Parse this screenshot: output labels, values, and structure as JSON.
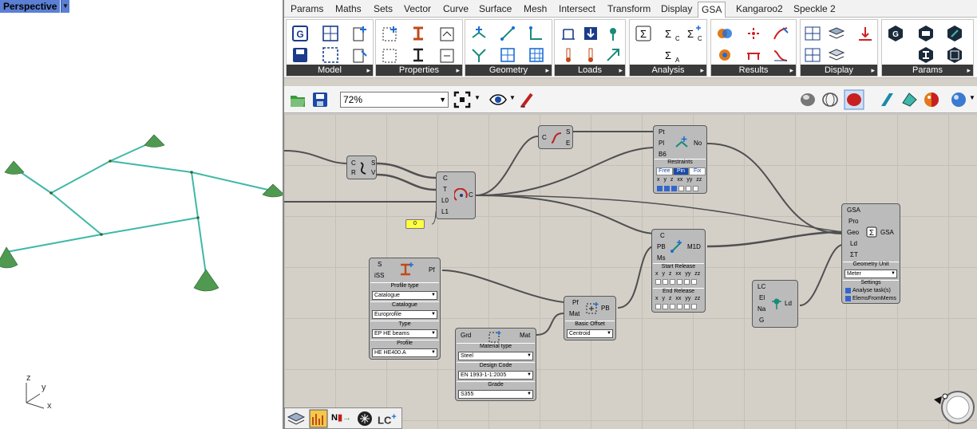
{
  "viewport": {
    "title": "Perspective",
    "axis": {
      "z": "z",
      "y": "y",
      "x": "x"
    }
  },
  "tabs": [
    "Params",
    "Maths",
    "Sets",
    "Vector",
    "Curve",
    "Surface",
    "Mesh",
    "Intersect",
    "Transform",
    "Display",
    "GSA",
    "Kangaroo2",
    "Speckle 2"
  ],
  "active_tab": "GSA",
  "ribbon_panels": [
    "Model",
    "Properties",
    "Geometry",
    "Loads",
    "Analysis",
    "Results",
    "Display",
    "Params"
  ],
  "toolbar": {
    "zoom": "72%"
  },
  "components": {
    "offset": {
      "in1": "C",
      "in2": "R",
      "out1": "S",
      "out2": "V"
    },
    "curve": {
      "in": "C",
      "out1": "S",
      "out2": "E"
    },
    "arc": {
      "in1": "C",
      "in2": "T",
      "in3": "L0",
      "in4": "L1",
      "out": "C"
    },
    "panel_value": "0",
    "node": {
      "in1": "Pt",
      "in2": "Pl",
      "in3": "B6",
      "out": "No",
      "restraints_label": "Restraints",
      "buttons": [
        "Free",
        "Pin",
        "Fix"
      ],
      "axes": [
        "x",
        "y",
        "z",
        "xx",
        "yy",
        "zz"
      ]
    },
    "element1d": {
      "in1": "C",
      "in2": "PB",
      "in3": "Ms",
      "out": "M1D",
      "start_release": "Start Release",
      "end_release": "End Release",
      "axes": [
        "x",
        "y",
        "z",
        "xx",
        "yy",
        "zz"
      ]
    },
    "profile": {
      "in1": "S",
      "in2": "iSS",
      "out": "Pf",
      "label_type": "Profile type",
      "value_type": "Catalogue",
      "label_catalogue": "Catalogue",
      "value_catalogue": "Europrofile",
      "label_kind": "Type",
      "value_kind": "EP HE beams",
      "label_profile": "Profile",
      "value_profile": "HE HE400.A"
    },
    "section": {
      "in1": "Pf",
      "in2": "Mat",
      "out": "PB",
      "label_offset": "Basic Offset",
      "value_offset": "Centroid"
    },
    "material": {
      "in": "Grd",
      "out": "Mat",
      "label_type": "Material type",
      "value_type": "Steel",
      "label_code": "Design Code",
      "value_code": "EN 1993-1-1:2005",
      "label_grade": "Grade",
      "value_grade": "S355"
    },
    "load": {
      "in1": "LC",
      "in2": "El",
      "in3": "Na",
      "in4": "G",
      "out": "Ld"
    },
    "model": {
      "in1": "GSA",
      "in2": "Pro",
      "in3": "Geo",
      "in4": "Ld",
      "in5": "ΣT",
      "out": "GSA",
      "label_unit": "Geometry Unit",
      "value_unit": "Meter",
      "label_settings": "Settings",
      "opt1": "Analyse task(s)",
      "opt2": "ElemsFromMems"
    }
  },
  "bottombar": {
    "lc_label": "LC",
    "n_label": "N"
  }
}
